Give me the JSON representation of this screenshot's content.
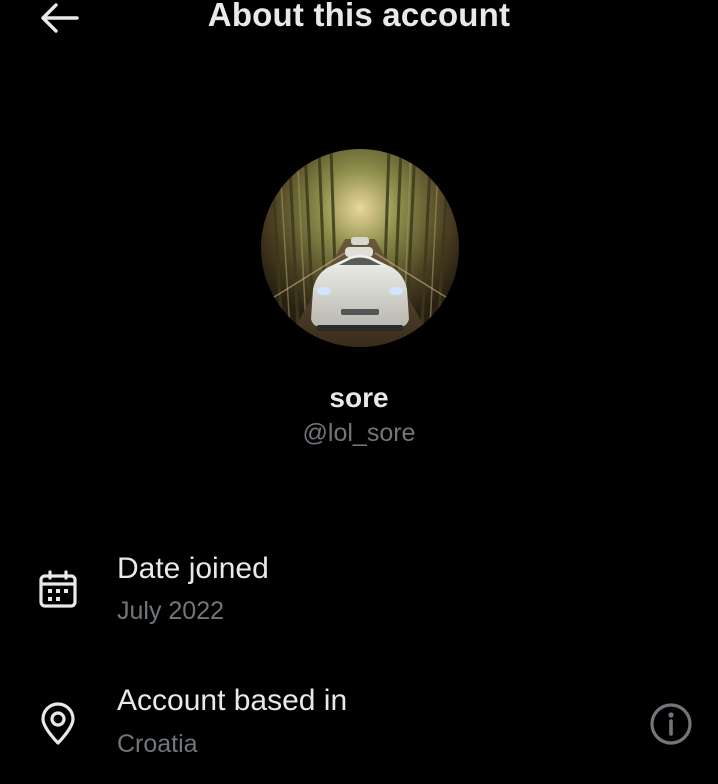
{
  "header": {
    "title": "About this account",
    "back_icon": "arrow-left-icon"
  },
  "profile": {
    "display_name": "sore",
    "handle": "@lol_sore",
    "avatar_description_icon": "profile-avatar"
  },
  "details": [
    {
      "icon": "calendar-icon",
      "title": "Date joined",
      "value": "July 2022"
    },
    {
      "icon": "location-pin-icon",
      "title": "Account based in",
      "value": "Croatia",
      "info_icon": "info-icon"
    }
  ],
  "colors": {
    "background": "#000000",
    "primary_text": "#e7e9ea",
    "secondary_text": "#71767b"
  }
}
